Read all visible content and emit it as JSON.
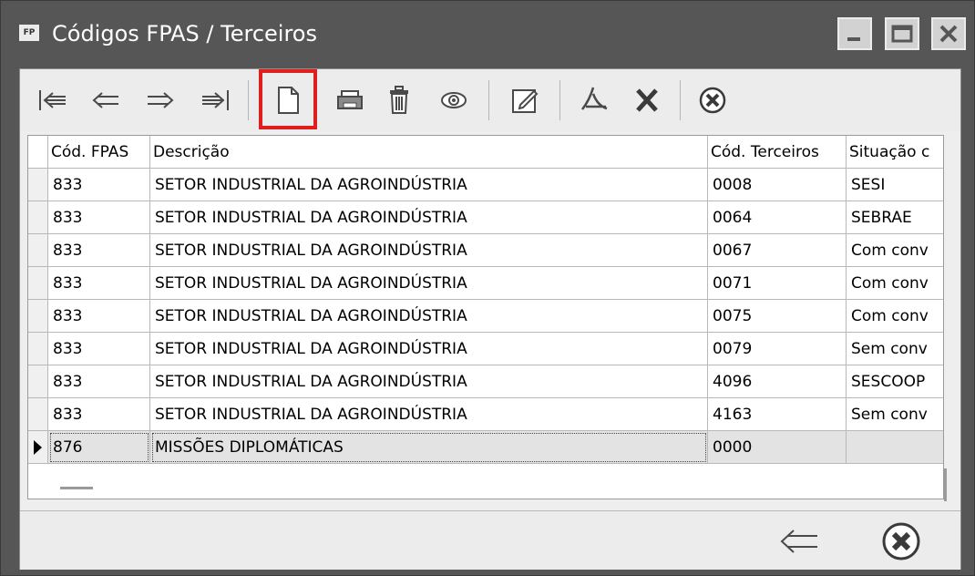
{
  "window": {
    "icon_text": "FP",
    "title": "Códigos FPAS / Terceiros"
  },
  "toolbar": {
    "buttons": [
      {
        "icon": "first-record-icon"
      },
      {
        "icon": "previous-record-icon"
      },
      {
        "icon": "next-record-icon"
      },
      {
        "icon": "last-record-icon"
      },
      {
        "icon": "new-document-icon",
        "highlighted": true
      },
      {
        "icon": "print-icon"
      },
      {
        "icon": "delete-icon"
      },
      {
        "icon": "view-icon"
      },
      {
        "icon": "edit-icon"
      },
      {
        "icon": "pdf-icon"
      },
      {
        "icon": "excel-icon"
      },
      {
        "icon": "close-circle-icon"
      }
    ]
  },
  "grid": {
    "columns": [
      "Cód. FPAS",
      "Descrição",
      "Cód. Terceiros",
      "Situação c"
    ],
    "rows": [
      {
        "fpas": "833",
        "descricao": "SETOR INDUSTRIAL DA AGROINDÚSTRIA",
        "terceiros": "0008",
        "situacao": "SESI"
      },
      {
        "fpas": "833",
        "descricao": "SETOR INDUSTRIAL DA AGROINDÚSTRIA",
        "terceiros": "0064",
        "situacao": "SEBRAE"
      },
      {
        "fpas": "833",
        "descricao": "SETOR INDUSTRIAL DA AGROINDÚSTRIA",
        "terceiros": "0067",
        "situacao": "Com conv"
      },
      {
        "fpas": "833",
        "descricao": "SETOR INDUSTRIAL DA AGROINDÚSTRIA",
        "terceiros": "0071",
        "situacao": "Com conv"
      },
      {
        "fpas": "833",
        "descricao": "SETOR INDUSTRIAL DA AGROINDÚSTRIA",
        "terceiros": "0075",
        "situacao": "Com conv"
      },
      {
        "fpas": "833",
        "descricao": "SETOR INDUSTRIAL DA AGROINDÚSTRIA",
        "terceiros": "0079",
        "situacao": "Sem conv"
      },
      {
        "fpas": "833",
        "descricao": "SETOR INDUSTRIAL DA AGROINDÚSTRIA",
        "terceiros": "4096",
        "situacao": "SESCOOP"
      },
      {
        "fpas": "833",
        "descricao": "SETOR INDUSTRIAL DA AGROINDÚSTRIA",
        "terceiros": "4163",
        "situacao": "Sem conv"
      },
      {
        "fpas": "876",
        "descricao": "MISSÕES DIPLOMÁTICAS",
        "terceiros": "0000",
        "situacao": "",
        "selected": true
      }
    ]
  },
  "footer": {
    "buttons": [
      {
        "icon": "back-arrow-icon"
      },
      {
        "icon": "close-circle-icon"
      }
    ]
  },
  "colors": {
    "titlebar": "#565656",
    "highlight": "#e01f1f",
    "selected_row": "#e3e3e3"
  }
}
